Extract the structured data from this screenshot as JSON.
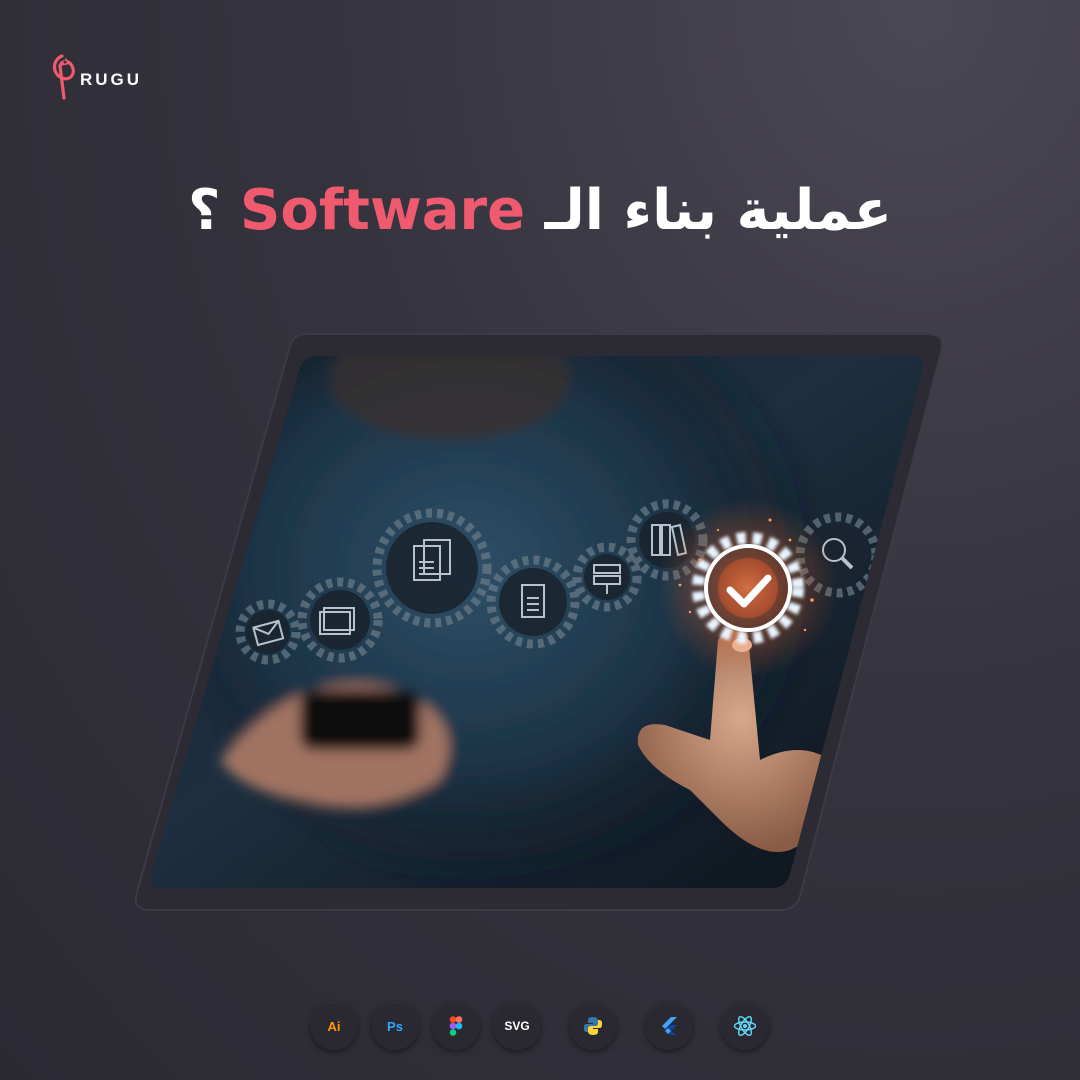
{
  "logo": {
    "text": "RUGU",
    "icon": "pen-nib-logo"
  },
  "headline": {
    "text_before": "عملية بناء الـ ",
    "accent": "Software",
    "text_after": " ؟"
  },
  "colors": {
    "accent": "#ef5a6f",
    "background": "#35333d",
    "frame": "#2c2b34"
  },
  "hero_image": {
    "description_icons": [
      "mail-icon",
      "monitor-icon",
      "documents-icon",
      "document-icon",
      "server-icon",
      "books-icon",
      "checkmark-gear-icon",
      "search-icon"
    ]
  },
  "tools": [
    {
      "label": "Ai",
      "color": "#ff9a00",
      "icon": "illustrator-icon"
    },
    {
      "label": "Ps",
      "color": "#31a8ff",
      "icon": "photoshop-icon"
    },
    {
      "label": "",
      "color": "#f24e1e",
      "icon": "figma-icon"
    },
    {
      "label": "SVG",
      "color": "#ffffff",
      "icon": "svg-icon"
    },
    {
      "label": "",
      "color": "#ffd43b",
      "icon": "python-icon"
    },
    {
      "label": "",
      "color": "#42a5f5",
      "icon": "flutter-icon"
    },
    {
      "label": "",
      "color": "#61dafb",
      "icon": "react-icon"
    }
  ]
}
